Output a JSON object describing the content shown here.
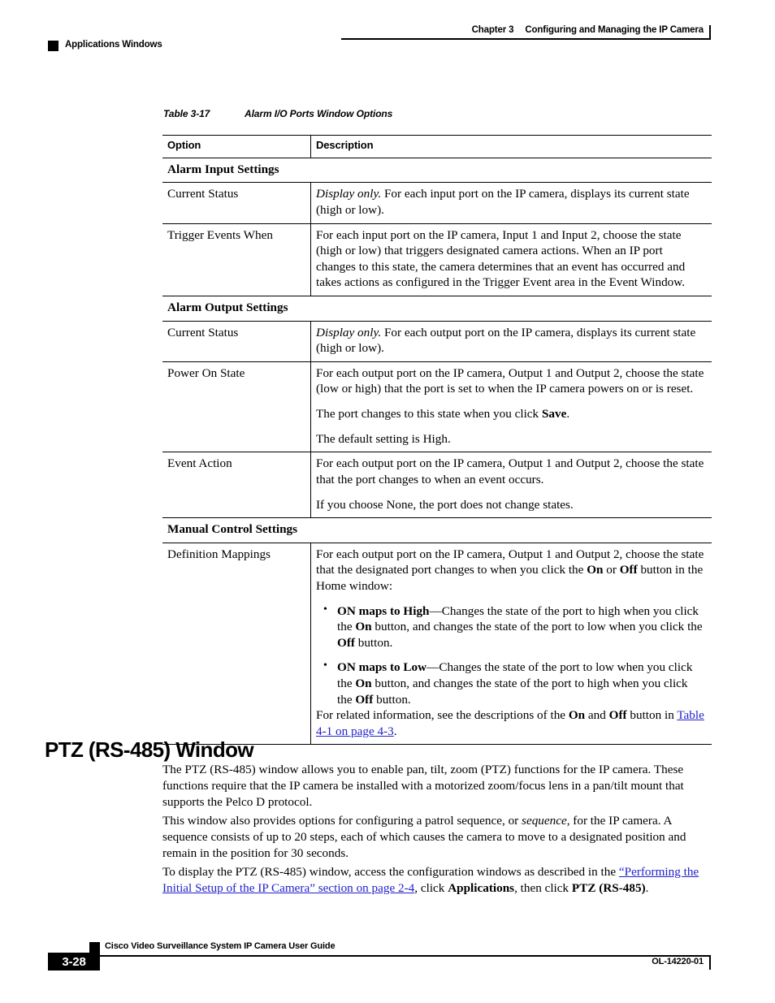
{
  "header": {
    "chapter_label": "Chapter 3",
    "chapter_title": "Configuring and Managing the IP Camera",
    "section_label": "Applications Windows"
  },
  "table": {
    "caption_number": "Table 3-17",
    "caption_title": "Alarm I/O Ports Window Options",
    "columns": {
      "option": "Option",
      "description": "Description"
    },
    "sections": [
      {
        "heading": "Alarm Input Settings",
        "rows": [
          {
            "option": "Current Status",
            "desc_lead_italic": "Display only.",
            "desc_paragraphs": [
              " For each input port on the IP camera, displays its current state (high or low)."
            ]
          },
          {
            "option": "Trigger Events When",
            "desc_paragraphs": [
              "For each input port on the IP camera, Input 1 and Input 2, choose the state (high or low) that triggers designated camera actions. When an IP port changes to this state, the camera determines that an event has occurred and takes actions as configured in the Trigger Event area in the Event Window."
            ]
          }
        ]
      },
      {
        "heading": "Alarm Output Settings",
        "rows": [
          {
            "option": "Current Status",
            "desc_lead_italic": "Display only.",
            "desc_paragraphs": [
              " For each output port on the IP camera, displays its current state (high or low)."
            ]
          },
          {
            "option": "Power On State",
            "desc_paragraphs": [
              "For each output port on the IP camera, Output 1 and Output 2, choose the state (low or high) that the port is set to when the IP camera powers on or is reset.",
              "The default setting is High."
            ],
            "desc_save_sentence": {
              "before": "The port changes to this state when you click ",
              "bold": "Save",
              "after": "."
            }
          },
          {
            "option": "Event Action",
            "desc_paragraphs": [
              "For each output port on the IP camera, Output 1 and Output 2, choose the state that the port changes to when an event occurs.",
              "If you choose None, the port does not change states."
            ]
          }
        ]
      },
      {
        "heading": "Manual Control Settings",
        "rows": [
          {
            "option": "Definition Mappings",
            "intro": {
              "p1": "For each output port on the IP camera, Output 1 and Output 2, choose the state that the designated port changes to when you click the ",
              "b1": "On",
              "p2": " or ",
              "b2": "Off",
              "p3": " button in the Home window:"
            },
            "bullets": [
              {
                "bold_term": "ON maps to High",
                "t1": "—Changes the state of the port to high when you click the ",
                "b1": "On",
                "t2": " button, and changes the state of the port to low when you click the ",
                "b2": "Off",
                "t3": " button."
              },
              {
                "bold_term": "ON maps to Low",
                "t1": "—Changes the state of the port to low when you click the ",
                "b1": "On",
                "t2": " button, and changes the state of the port to high when you click the ",
                "b2": "Off",
                "t3": " button."
              }
            ],
            "footer_note": {
              "t1": "For related information, see the descriptions of the ",
              "b1": "On",
              "t2": " and ",
              "b2": "Off",
              "t3": " button in ",
              "link": "Table 4-1 on page 4-3",
              "t4": "."
            }
          }
        ]
      }
    ]
  },
  "ptz_section": {
    "heading": "PTZ (RS-485) Window",
    "paragraph_1": "The PTZ (RS-485) window allows you to enable pan, tilt, zoom (PTZ) functions for the IP camera. These functions require that the IP camera be installed with a motorized zoom/focus lens in a pan/tilt mount that supports the Pelco D protocol.",
    "paragraph_2": {
      "t1": "This window also provides options for configuring a patrol sequence, or ",
      "italic": "sequence",
      "t2": ", for the IP camera. A sequence consists of up to 20 steps, each of which causes the camera to move to a designated position and remain in the position for 30 seconds."
    },
    "paragraph_3": {
      "t1": "To display the PTZ (RS-485) window, access the configuration windows as described in the ",
      "link": "“Performing the Initial Setup of the IP Camera” section on page 2-4",
      "t2": ", click ",
      "b1": "Applications",
      "t3": ", then click ",
      "b2": "PTZ (RS-485)",
      "t4": "."
    }
  },
  "footer": {
    "guide_title": "Cisco Video Surveillance System IP Camera User Guide",
    "page_number": "3-28",
    "doc_id": "OL-14220-01"
  },
  "colors": {
    "link": "#2222CC",
    "rule": "#000000",
    "page_background": "#FFFFFF"
  }
}
